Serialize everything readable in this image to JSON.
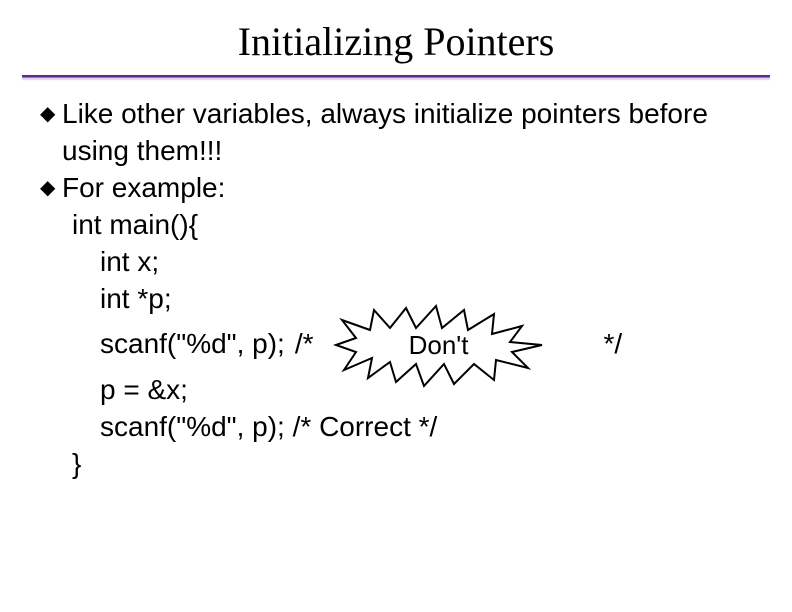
{
  "slide": {
    "title": "Initializing Pointers",
    "bullets": [
      "Like other variables, always initialize pointers before using them!!!",
      "For example:"
    ],
    "code": {
      "line1": "int main(){",
      "line2": "int x;",
      "line3": "int *p;",
      "line4_a": "scanf(\"%d\", p);",
      "line4_b": "/*",
      "line4_burst": "Don't",
      "line4_c": "*/",
      "line5": "p = &x;",
      "line6": "scanf(\"%d\", p);  /* Correct */",
      "line7": "}"
    }
  }
}
